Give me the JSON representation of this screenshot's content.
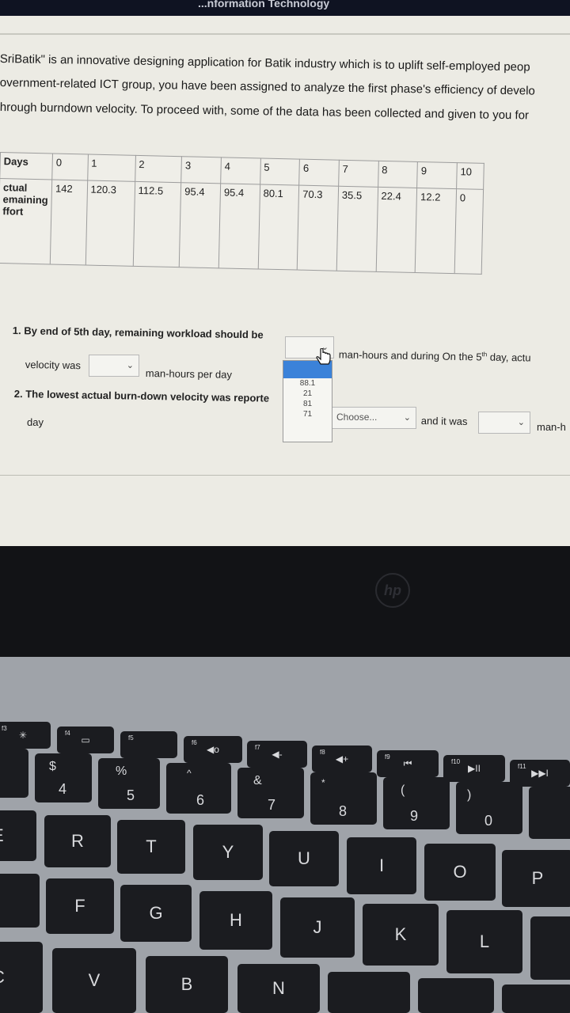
{
  "window": {
    "title": "...nformation Technology"
  },
  "intro": [
    "SriBatik\" is an innovative designing application for Batik industry which is to uplift self-employed peop",
    "overnment-related ICT group, you have been assigned to analyze the first phase's efficiency of develo",
    "hrough burndown velocity. To proceed with, some of the data has been collected and given to you for"
  ],
  "table": {
    "row1_label": "Days",
    "row2_label": [
      "ctual",
      "emaining",
      "ffort"
    ],
    "days": [
      "0",
      "1",
      "2",
      "3",
      "4",
      "5",
      "6",
      "7",
      "8",
      "9",
      "10"
    ],
    "remaining": [
      "142",
      "120.3",
      "112.5",
      "95.4",
      "95.4",
      "80.1",
      "70.3",
      "35.5",
      "22.4",
      "12.2",
      "0"
    ]
  },
  "q1": {
    "text_a": "1. By end of 5th day, remaining workload should be",
    "text_b": "man-hours and during On the 5",
    "sup": "th",
    "text_c": "day, actu",
    "text_d": "velocity was",
    "text_e": "man-hours per day"
  },
  "q2": {
    "text_a": "2. The lowest actual burn-down velocity was reporte",
    "select_placeholder": "Choose...",
    "text_b": "and it was",
    "text_c": "man-h",
    "text_d": "day"
  },
  "dropdown_options": [
    "88.1",
    "21",
    "81",
    "71"
  ],
  "laptop": {
    "brand": "hp",
    "fn_row": [
      "f3",
      "f4",
      "f5",
      "f6",
      "f7",
      "f8",
      "f9",
      "f10",
      "f11"
    ],
    "fn_icons": [
      "✳",
      "▭",
      "",
      "◀o",
      "◀-",
      "◀+",
      "⏮",
      "▶II",
      "▶▶I"
    ],
    "num_row": [
      {
        "top": "$",
        "main": "4"
      },
      {
        "top": "%",
        "main": "5"
      },
      {
        "top": "^",
        "main": "6"
      },
      {
        "top": "&",
        "main": "7"
      },
      {
        "top": "*",
        "main": "8"
      },
      {
        "top": "(",
        "main": "9"
      },
      {
        "top": ")",
        "main": "0"
      }
    ],
    "row_q": [
      "E",
      "R",
      "T",
      "Y",
      "U",
      "I",
      "O",
      "P"
    ],
    "row_a": [
      "F",
      "G",
      "H",
      "J",
      "K",
      "L"
    ],
    "row_z": [
      "C",
      "V",
      "B",
      "N"
    ]
  }
}
